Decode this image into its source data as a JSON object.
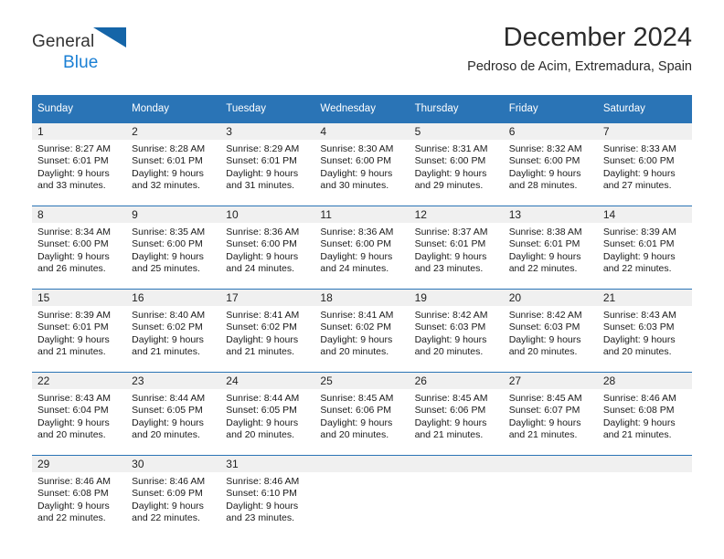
{
  "brand": {
    "line1": "General",
    "line2": "Blue",
    "logo_icon": "triangle-logo-icon",
    "accent_color": "#1a7fd4"
  },
  "header": {
    "title": "December 2024",
    "location": "Pedroso de Acim, Extremadura, Spain"
  },
  "theme": {
    "header_row_color": "#2a74b6",
    "daynum_band_color": "#f0f0f0",
    "separator_color": "#2a74b6"
  },
  "calendar": {
    "weekday_headers": [
      "Sunday",
      "Monday",
      "Tuesday",
      "Wednesday",
      "Thursday",
      "Friday",
      "Saturday"
    ],
    "weeks": [
      [
        {
          "day": "1",
          "sunrise": "Sunrise: 8:27 AM",
          "sunset": "Sunset: 6:01 PM",
          "daylight1": "Daylight: 9 hours",
          "daylight2": "and 33 minutes."
        },
        {
          "day": "2",
          "sunrise": "Sunrise: 8:28 AM",
          "sunset": "Sunset: 6:01 PM",
          "daylight1": "Daylight: 9 hours",
          "daylight2": "and 32 minutes."
        },
        {
          "day": "3",
          "sunrise": "Sunrise: 8:29 AM",
          "sunset": "Sunset: 6:01 PM",
          "daylight1": "Daylight: 9 hours",
          "daylight2": "and 31 minutes."
        },
        {
          "day": "4",
          "sunrise": "Sunrise: 8:30 AM",
          "sunset": "Sunset: 6:00 PM",
          "daylight1": "Daylight: 9 hours",
          "daylight2": "and 30 minutes."
        },
        {
          "day": "5",
          "sunrise": "Sunrise: 8:31 AM",
          "sunset": "Sunset: 6:00 PM",
          "daylight1": "Daylight: 9 hours",
          "daylight2": "and 29 minutes."
        },
        {
          "day": "6",
          "sunrise": "Sunrise: 8:32 AM",
          "sunset": "Sunset: 6:00 PM",
          "daylight1": "Daylight: 9 hours",
          "daylight2": "and 28 minutes."
        },
        {
          "day": "7",
          "sunrise": "Sunrise: 8:33 AM",
          "sunset": "Sunset: 6:00 PM",
          "daylight1": "Daylight: 9 hours",
          "daylight2": "and 27 minutes."
        }
      ],
      [
        {
          "day": "8",
          "sunrise": "Sunrise: 8:34 AM",
          "sunset": "Sunset: 6:00 PM",
          "daylight1": "Daylight: 9 hours",
          "daylight2": "and 26 minutes."
        },
        {
          "day": "9",
          "sunrise": "Sunrise: 8:35 AM",
          "sunset": "Sunset: 6:00 PM",
          "daylight1": "Daylight: 9 hours",
          "daylight2": "and 25 minutes."
        },
        {
          "day": "10",
          "sunrise": "Sunrise: 8:36 AM",
          "sunset": "Sunset: 6:00 PM",
          "daylight1": "Daylight: 9 hours",
          "daylight2": "and 24 minutes."
        },
        {
          "day": "11",
          "sunrise": "Sunrise: 8:36 AM",
          "sunset": "Sunset: 6:00 PM",
          "daylight1": "Daylight: 9 hours",
          "daylight2": "and 24 minutes."
        },
        {
          "day": "12",
          "sunrise": "Sunrise: 8:37 AM",
          "sunset": "Sunset: 6:01 PM",
          "daylight1": "Daylight: 9 hours",
          "daylight2": "and 23 minutes."
        },
        {
          "day": "13",
          "sunrise": "Sunrise: 8:38 AM",
          "sunset": "Sunset: 6:01 PM",
          "daylight1": "Daylight: 9 hours",
          "daylight2": "and 22 minutes."
        },
        {
          "day": "14",
          "sunrise": "Sunrise: 8:39 AM",
          "sunset": "Sunset: 6:01 PM",
          "daylight1": "Daylight: 9 hours",
          "daylight2": "and 22 minutes."
        }
      ],
      [
        {
          "day": "15",
          "sunrise": "Sunrise: 8:39 AM",
          "sunset": "Sunset: 6:01 PM",
          "daylight1": "Daylight: 9 hours",
          "daylight2": "and 21 minutes."
        },
        {
          "day": "16",
          "sunrise": "Sunrise: 8:40 AM",
          "sunset": "Sunset: 6:02 PM",
          "daylight1": "Daylight: 9 hours",
          "daylight2": "and 21 minutes."
        },
        {
          "day": "17",
          "sunrise": "Sunrise: 8:41 AM",
          "sunset": "Sunset: 6:02 PM",
          "daylight1": "Daylight: 9 hours",
          "daylight2": "and 21 minutes."
        },
        {
          "day": "18",
          "sunrise": "Sunrise: 8:41 AM",
          "sunset": "Sunset: 6:02 PM",
          "daylight1": "Daylight: 9 hours",
          "daylight2": "and 20 minutes."
        },
        {
          "day": "19",
          "sunrise": "Sunrise: 8:42 AM",
          "sunset": "Sunset: 6:03 PM",
          "daylight1": "Daylight: 9 hours",
          "daylight2": "and 20 minutes."
        },
        {
          "day": "20",
          "sunrise": "Sunrise: 8:42 AM",
          "sunset": "Sunset: 6:03 PM",
          "daylight1": "Daylight: 9 hours",
          "daylight2": "and 20 minutes."
        },
        {
          "day": "21",
          "sunrise": "Sunrise: 8:43 AM",
          "sunset": "Sunset: 6:03 PM",
          "daylight1": "Daylight: 9 hours",
          "daylight2": "and 20 minutes."
        }
      ],
      [
        {
          "day": "22",
          "sunrise": "Sunrise: 8:43 AM",
          "sunset": "Sunset: 6:04 PM",
          "daylight1": "Daylight: 9 hours",
          "daylight2": "and 20 minutes."
        },
        {
          "day": "23",
          "sunrise": "Sunrise: 8:44 AM",
          "sunset": "Sunset: 6:05 PM",
          "daylight1": "Daylight: 9 hours",
          "daylight2": "and 20 minutes."
        },
        {
          "day": "24",
          "sunrise": "Sunrise: 8:44 AM",
          "sunset": "Sunset: 6:05 PM",
          "daylight1": "Daylight: 9 hours",
          "daylight2": "and 20 minutes."
        },
        {
          "day": "25",
          "sunrise": "Sunrise: 8:45 AM",
          "sunset": "Sunset: 6:06 PM",
          "daylight1": "Daylight: 9 hours",
          "daylight2": "and 20 minutes."
        },
        {
          "day": "26",
          "sunrise": "Sunrise: 8:45 AM",
          "sunset": "Sunset: 6:06 PM",
          "daylight1": "Daylight: 9 hours",
          "daylight2": "and 21 minutes."
        },
        {
          "day": "27",
          "sunrise": "Sunrise: 8:45 AM",
          "sunset": "Sunset: 6:07 PM",
          "daylight1": "Daylight: 9 hours",
          "daylight2": "and 21 minutes."
        },
        {
          "day": "28",
          "sunrise": "Sunrise: 8:46 AM",
          "sunset": "Sunset: 6:08 PM",
          "daylight1": "Daylight: 9 hours",
          "daylight2": "and 21 minutes."
        }
      ],
      [
        {
          "day": "29",
          "sunrise": "Sunrise: 8:46 AM",
          "sunset": "Sunset: 6:08 PM",
          "daylight1": "Daylight: 9 hours",
          "daylight2": "and 22 minutes."
        },
        {
          "day": "30",
          "sunrise": "Sunrise: 8:46 AM",
          "sunset": "Sunset: 6:09 PM",
          "daylight1": "Daylight: 9 hours",
          "daylight2": "and 22 minutes."
        },
        {
          "day": "31",
          "sunrise": "Sunrise: 8:46 AM",
          "sunset": "Sunset: 6:10 PM",
          "daylight1": "Daylight: 9 hours",
          "daylight2": "and 23 minutes."
        },
        {
          "day": "",
          "sunrise": "",
          "sunset": "",
          "daylight1": "",
          "daylight2": ""
        },
        {
          "day": "",
          "sunrise": "",
          "sunset": "",
          "daylight1": "",
          "daylight2": ""
        },
        {
          "day": "",
          "sunrise": "",
          "sunset": "",
          "daylight1": "",
          "daylight2": ""
        },
        {
          "day": "",
          "sunrise": "",
          "sunset": "",
          "daylight1": "",
          "daylight2": ""
        }
      ]
    ]
  }
}
